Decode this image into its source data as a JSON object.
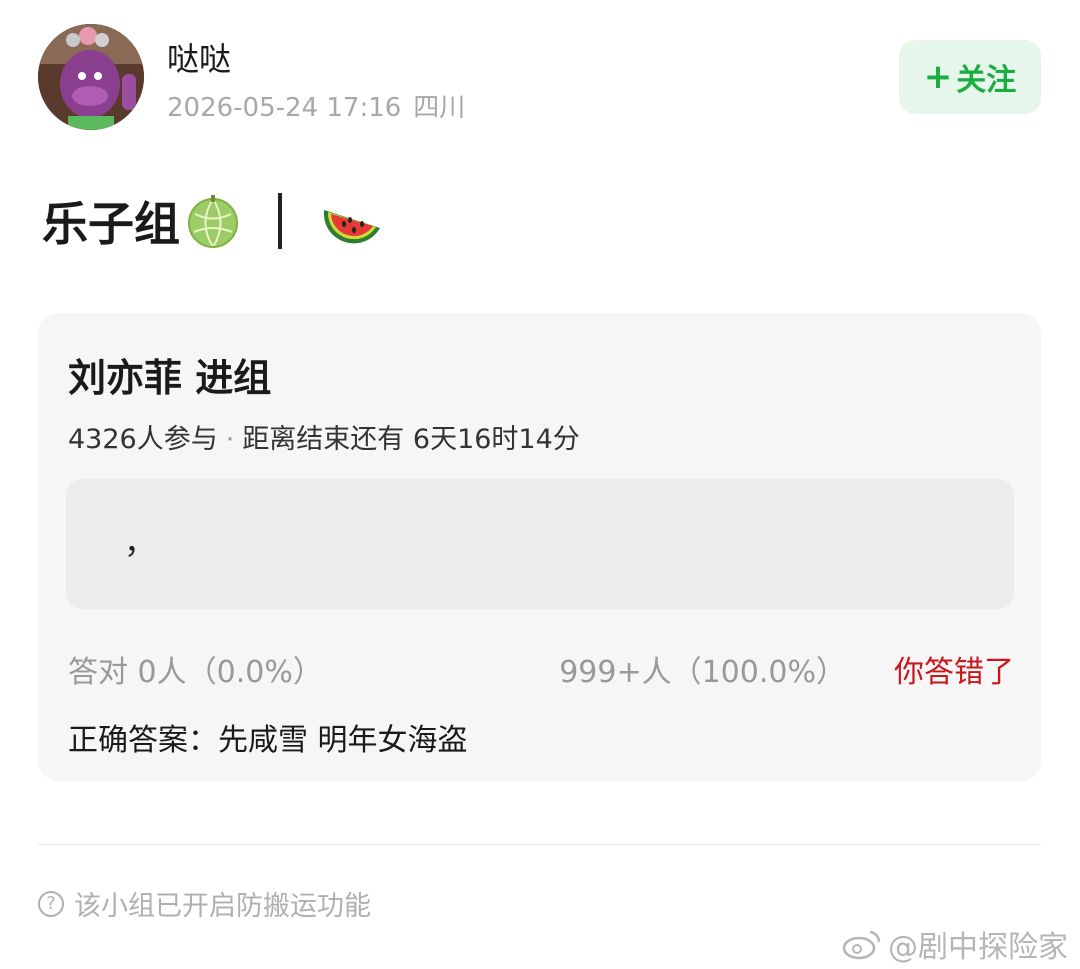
{
  "post": {
    "username": "哒哒",
    "timestamp": "2026-05-24 17:16",
    "location": "四川",
    "follow_label": "关注",
    "follow_icon": "plus-icon"
  },
  "group": {
    "title": "乐子组",
    "emoji_1": "melon-icon",
    "emoji_2": "watermelon-icon"
  },
  "quiz": {
    "title": "刘亦菲 进组",
    "participants": "4326人参与",
    "time_left": "距离结束还有 6天16时14分",
    "answer_text": "，",
    "correct_stats": "答对  0人（0.0%）",
    "wrong_stats": "999+人（100.0%）",
    "result_label": "你答错了",
    "correct_answer": "正确答案：先咸雪 明年女海盗"
  },
  "footer": {
    "notice": "该小组已开启防搬运功能",
    "watermark": "@剧中探险家"
  },
  "colors": {
    "accent_green": "#1aad42",
    "follow_bg": "#e7f6ea",
    "wrong_red": "#c8161d",
    "card_bg": "#f6f6f6"
  }
}
